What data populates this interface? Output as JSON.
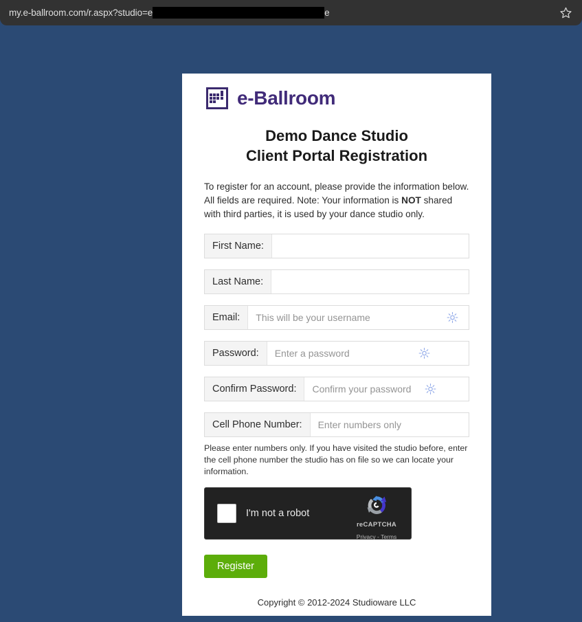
{
  "browser": {
    "url_prefix": "my.e-ballroom.com/r.aspx?studio=e",
    "url_suffix": "e",
    "bookmark_icon": "star-icon"
  },
  "brand": {
    "logo_icon": "calendar-grid-icon",
    "name": "e-Ballroom",
    "color": "#412b79"
  },
  "heading": {
    "line1": "Demo Dance Studio",
    "line2": "Client Portal Registration"
  },
  "intro": {
    "part1": "To register for an account, please provide the information below. All fields are required. Note: Your information is ",
    "emphasis": "NOT",
    "part2": " shared with third parties, it is used by your dance studio only."
  },
  "form": {
    "fields": [
      {
        "label": "First Name:",
        "value": "",
        "placeholder": ""
      },
      {
        "label": "Last Name:",
        "value": "",
        "placeholder": ""
      },
      {
        "label": "Email:",
        "value": "",
        "placeholder": "This will be your username"
      },
      {
        "label": "Password:",
        "value": "",
        "placeholder": "Enter a password"
      },
      {
        "label": "Confirm Password:",
        "value": "",
        "placeholder": "Confirm your password"
      },
      {
        "label": "Cell Phone Number:",
        "value": "",
        "placeholder": "Enter numbers only"
      }
    ],
    "help_text": "Please enter numbers only. If you have visited the studio before, enter the cell phone number the studio has on file so we can locate your information.",
    "autofill_icon": "sparkle-icon"
  },
  "recaptcha": {
    "label": "I'm not a robot",
    "brand_name": "reCAPTCHA",
    "links": "Privacy - Terms",
    "logo_icon": "recaptcha-logo-icon",
    "checked": false
  },
  "actions": {
    "register_label": "Register",
    "register_color": "#5cad0a"
  },
  "footer": {
    "copyright": "Copyright © 2012-2024 Studioware LLC"
  }
}
